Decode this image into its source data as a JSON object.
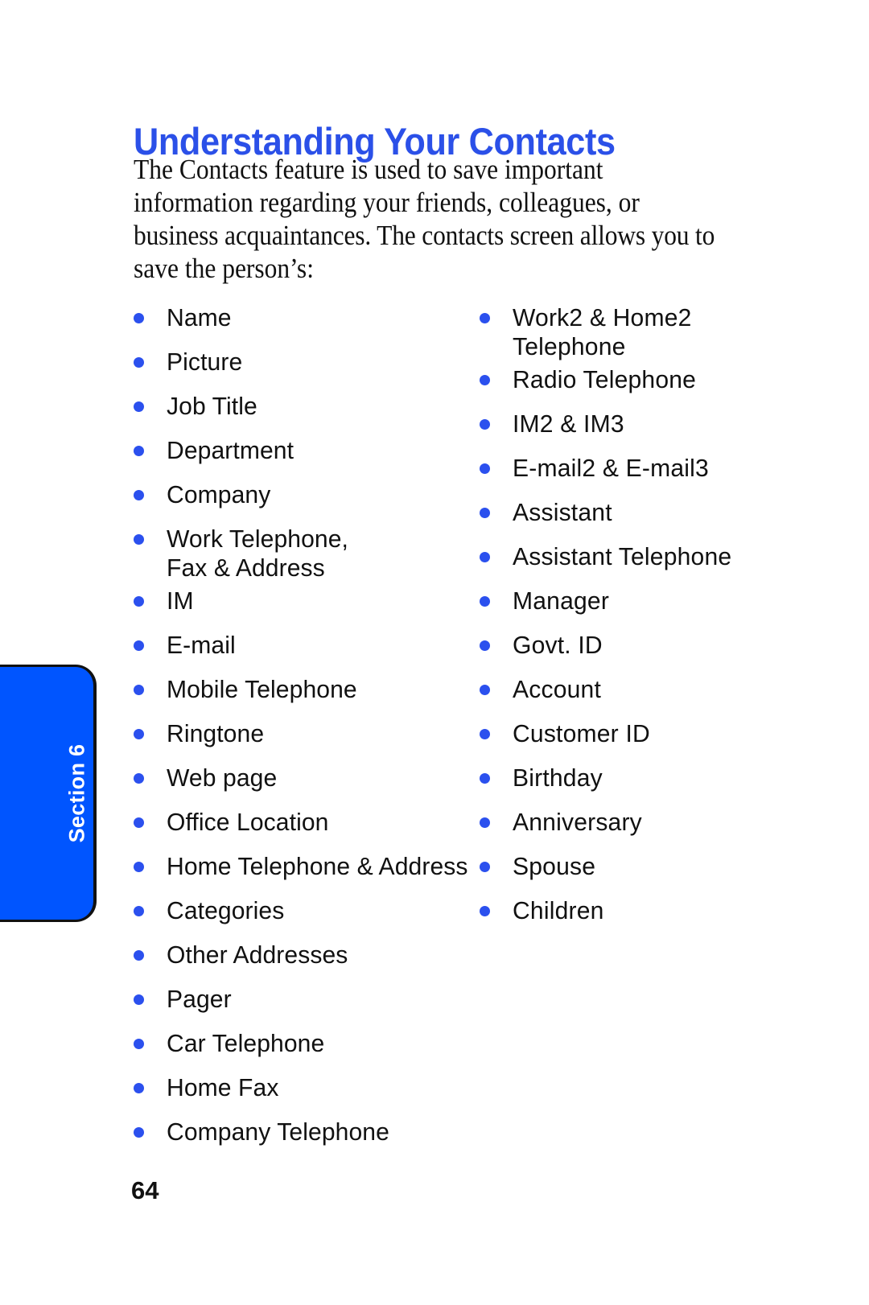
{
  "document": {
    "page_number": "64",
    "section_tab": {
      "label": "Section 6",
      "background_color": "#0055FF",
      "text_color": "#FFFFFF"
    },
    "title": "Understanding Your Contacts",
    "title_color": "#2B50E8",
    "bullet_color": "#2B50EE",
    "intro_paragraph": {
      "full_text": "The Contacts feature is used to save important information regarding your friends, colleagues, or business acquaintances. The contacts screen allows you to save the person's:",
      "lines": [
        "The Contacts feature is used to save important",
        "information regarding your friends, colleagues, or",
        "business acquaintances. The contacts screen allows you to",
        "save the person’s:"
      ]
    },
    "bullet_columns": {
      "left": [
        "Name",
        "Picture",
        "Job Title",
        "Department",
        "Company",
        "Work Telephone, Fax & Address",
        "IM",
        "E-mail",
        "Mobile Telephone",
        "Ringtone",
        "Web page",
        "Office Location",
        "Home Telephone & Address",
        "Categories",
        "Other Addresses",
        "Pager",
        "Car Telephone",
        "Home Fax",
        "Company Telephone"
      ],
      "right": [
        "Work2 & Home2 Telephone",
        "Radio Telephone",
        "IM2 & IM3",
        "E-mail2 & E-mail3",
        "Assistant",
        "Assistant Telephone",
        "Manager",
        "Govt. ID",
        "Account",
        "Customer ID",
        "Birthday",
        "Anniversary",
        "Spouse",
        "Children"
      ]
    }
  }
}
